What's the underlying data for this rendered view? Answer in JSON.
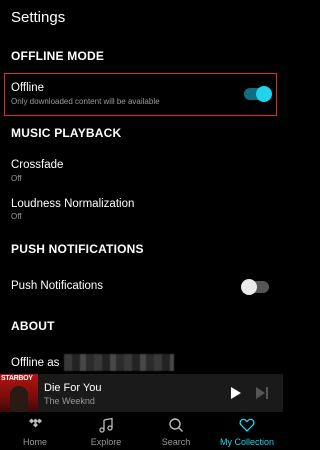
{
  "header": {
    "title": "Settings"
  },
  "sections": {
    "offline_mode": "OFFLINE MODE",
    "music_playback": "MUSIC PLAYBACK",
    "push_notifications": "PUSH NOTIFICATIONS",
    "about": "ABOUT"
  },
  "offline": {
    "title": "Offline",
    "subtitle": "Only downloaded content will be available",
    "enabled": true
  },
  "crossfade": {
    "title": "Crossfade",
    "value": "Off"
  },
  "loudness": {
    "title": "Loudness Normalization",
    "value": "Off"
  },
  "push": {
    "title": "Push Notifications",
    "enabled": false
  },
  "about": {
    "offline_as": "Offline as"
  },
  "player": {
    "album_text": "STARBOY",
    "song": "Die For You",
    "artist": "The Weeknd"
  },
  "tabs": [
    {
      "label": "Home",
      "icon": "tidal-logo-icon"
    },
    {
      "label": "Explore",
      "icon": "music-note-icon"
    },
    {
      "label": "Search",
      "icon": "search-icon"
    },
    {
      "label": "My Collection",
      "icon": "heart-icon",
      "active": true
    }
  ],
  "colors": {
    "accent": "#22d3ee",
    "highlight": "#e02a2a",
    "background": "#000000"
  }
}
